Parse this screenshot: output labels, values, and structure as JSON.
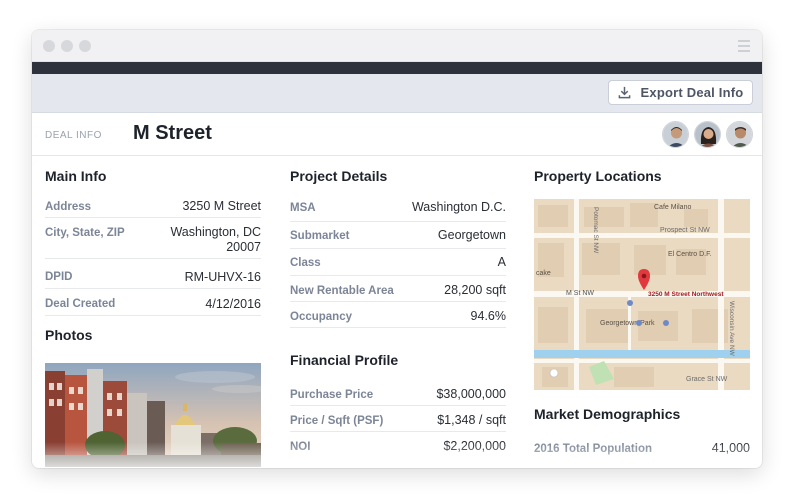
{
  "toolbar": {
    "export_label": "Export Deal Info"
  },
  "header": {
    "section_label": "DEAL INFO",
    "title": "M Street"
  },
  "main_info": {
    "title": "Main Info",
    "rows": [
      {
        "label": "Address",
        "value": "3250 M Street"
      },
      {
        "label": "City, State, ZIP",
        "value": "Washington, DC",
        "value2": "20007"
      },
      {
        "label": "DPID",
        "value": "RM-UHVX-16"
      },
      {
        "label": "Deal Created",
        "value": "4/12/2016"
      }
    ]
  },
  "photos": {
    "title": "Photos"
  },
  "project_details": {
    "title": "Project Details",
    "rows": [
      {
        "label": "MSA",
        "value": "Washington D.C."
      },
      {
        "label": "Submarket",
        "value": "Georgetown"
      },
      {
        "label": "Class",
        "value": "A"
      },
      {
        "label": "New Rentable Area",
        "value": "28,200 sqft"
      },
      {
        "label": "Occupancy",
        "value": "94.6%"
      }
    ]
  },
  "financial_profile": {
    "title": "Financial Profile",
    "rows": [
      {
        "label": "Purchase Price",
        "value": "$38,000,000"
      },
      {
        "label": "Price / Sqft (PSF)",
        "value": "$1,348 / sqft"
      },
      {
        "label": "NOI",
        "value": "$2,200,000"
      }
    ]
  },
  "property_locations": {
    "title": "Property Locations",
    "map_labels": {
      "cafe": "Cafe Milano",
      "prospect": "Prospect St NW",
      "elcentro": "El Centro D.F.",
      "potomac": "Potomac St NW",
      "cake": "cake",
      "mst": "M St NW",
      "marker": "3250 M Street Northwest",
      "gpark": "Georgetown Park",
      "wisconsin": "Wisconsin Ave NW",
      "grace": "Grace St NW"
    }
  },
  "market_demographics": {
    "title": "Market Demographics",
    "rows": [
      {
        "label": "2016 Total Population",
        "value": "41,000"
      }
    ]
  },
  "colors": {
    "dark_bar": "#2c313c",
    "toolbar_bg": "#e4e8ee",
    "label": "#7c8597",
    "marker": "#e0393e",
    "water": "#9fd1ee"
  }
}
